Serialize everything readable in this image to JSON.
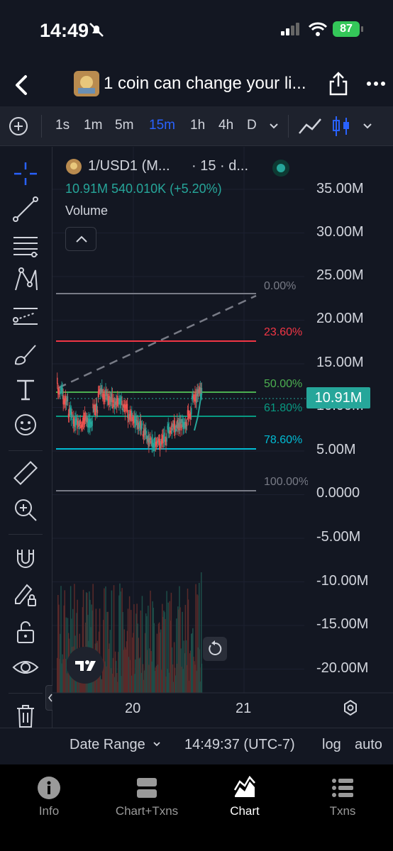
{
  "status_bar": {
    "time": "14:49",
    "battery": "87"
  },
  "header": {
    "title": "1 coin can change your li..."
  },
  "toolbar": {
    "timeframes": [
      "1s",
      "1m",
      "5m",
      "15m",
      "1h",
      "4h",
      "D"
    ],
    "active_timeframe": "15m"
  },
  "legend": {
    "symbol": "1/USD1 (M...",
    "interval": "· 15 · d...",
    "values": "10.91M  540.010K (+5.20%)",
    "volume_label": "Volume"
  },
  "price_axis": {
    "labels": [
      "35.00M",
      "30.00M",
      "25.00M",
      "20.00M",
      "15.00M",
      "10.00M",
      "5.00M",
      "0.0000",
      "-5.00M",
      "-10.00M",
      "-15.00M",
      "-20.00M"
    ],
    "last_price": "10.91M"
  },
  "fib_levels": [
    {
      "label": "0.00%",
      "color": "#787b86"
    },
    {
      "label": "23.60%",
      "color": "#f23645"
    },
    {
      "label": "50.00%",
      "color": "#4caf50"
    },
    {
      "label": "61.80%",
      "color": "#089981"
    },
    {
      "label": "78.60%",
      "color": "#00bcd4"
    },
    {
      "label": "100.00%",
      "color": "#787b86"
    }
  ],
  "time_axis": {
    "labels": [
      "20",
      "21"
    ]
  },
  "chart_bar": {
    "date_range": "Date Range",
    "clock": "14:49:37 (UTC-7)",
    "log": "log",
    "auto": "auto"
  },
  "tabs": [
    {
      "label": "Info"
    },
    {
      "label": "Chart+Txns"
    },
    {
      "label": "Chart"
    },
    {
      "label": "Txns"
    }
  ],
  "active_tab": "Chart",
  "colors": {
    "accent": "#2962ff",
    "up": "#26a69a",
    "down": "#ef5350",
    "background": "#131722"
  }
}
